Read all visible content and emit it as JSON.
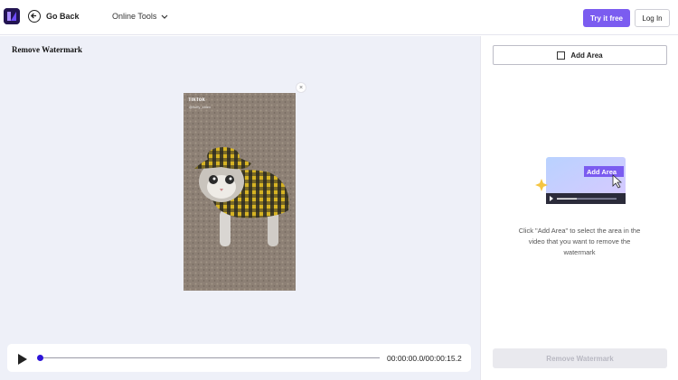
{
  "header": {
    "back_label": "Go Back",
    "online_tools_label": "Online Tools",
    "try_label": "Try it free",
    "login_label": "Log In",
    "accent_color": "#7b5cf0"
  },
  "editor": {
    "title": "Remove Watermark",
    "watermark_brand": "TikTok",
    "watermark_handle": "@fluffy_kitten",
    "close_glyph": "×",
    "time_readout": "00:00:00.0/00:00:15.2",
    "progress_fraction": 0.0
  },
  "panel": {
    "add_area_label": "Add Area",
    "illustration_badge": "Add Area",
    "help_text": "Click \"Add Area\" to select the area in the video that you want to remove the watermark",
    "remove_label": "Remove Watermark"
  },
  "icons": {
    "logo": "app-logo-icon",
    "back": "arrow-left-circle-icon",
    "chevron": "chevron-down-icon",
    "play": "play-icon",
    "square": "square-select-icon",
    "close": "close-icon"
  }
}
